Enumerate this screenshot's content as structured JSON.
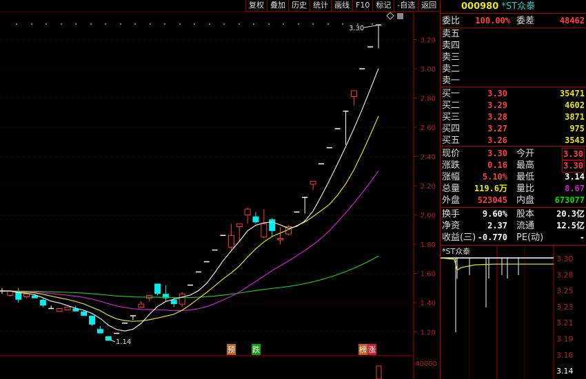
{
  "toolbar": [
    "复权",
    "叠加",
    "历史",
    "统计",
    "画线",
    "F10",
    "标记",
    "-自选",
    "返回"
  ],
  "stock": {
    "code": "000980",
    "name": "*ST众泰"
  },
  "weibi": {
    "label": "委比",
    "value": "100.00%",
    "label2": "委差",
    "value2": "48462"
  },
  "sell": [
    {
      "label": "卖五"
    },
    {
      "label": "卖四"
    },
    {
      "label": "卖三"
    },
    {
      "label": "卖二"
    },
    {
      "label": "卖一"
    }
  ],
  "buy": [
    {
      "label": "买一",
      "price": "3.30",
      "vol": "35471"
    },
    {
      "label": "买二",
      "price": "3.29",
      "vol": "4602"
    },
    {
      "label": "买三",
      "price": "3.28",
      "vol": "3871"
    },
    {
      "label": "买四",
      "price": "3.27",
      "vol": "975"
    },
    {
      "label": "买五",
      "price": "3.26",
      "vol": "3543"
    }
  ],
  "quote": [
    {
      "l1": "现价",
      "v1": "3.30",
      "c1": "red",
      "l2": "今开",
      "v2": "3.30",
      "c2": "red box"
    },
    {
      "l1": "涨跌",
      "v1": "0.16",
      "c1": "red",
      "l2": "最高",
      "v2": "3.30",
      "c2": "red box"
    },
    {
      "l1": "涨幅",
      "v1": "5.10%",
      "c1": "red",
      "l2": "最低",
      "v2": "3.14",
      "c2": "wht"
    },
    {
      "l1": "总量",
      "v1": "119.6万",
      "c1": "yel",
      "l2": "量比",
      "v2": "8.67",
      "c2": "pur"
    },
    {
      "l1": "外盘",
      "v1": "523045",
      "c1": "red",
      "l2": "内盘",
      "v2": "673077",
      "c2": "grn"
    }
  ],
  "fund": [
    {
      "l1": "换手",
      "v1": "9.60%",
      "l2": "股本",
      "v2": "20.3亿"
    },
    {
      "l1": "净资",
      "v1": "2.37",
      "l2": "流通",
      "v2": "12.5亿"
    },
    {
      "l1": "收益(三)",
      "v1": "-0.770",
      "l2": "PE(动)",
      "v2": "-"
    }
  ],
  "intraday": {
    "title": "*ST众泰",
    "axis": [
      "3.30",
      "3.28",
      "3.25",
      "3.23",
      "3.21",
      "3.19",
      "3.16",
      "3.14"
    ]
  },
  "markers": [
    {
      "text": "预",
      "color": "#c06020"
    },
    {
      "text": "跌",
      "color": "#10a010"
    },
    {
      "text": "榜",
      "color": "#c06020"
    },
    {
      "text": "涨",
      "color": "#c02030"
    }
  ],
  "colors": {
    "up": "#ff3c3c",
    "down": "#00f0f0",
    "ma5": "#e8e8e8",
    "ma10": "#e0e020",
    "ma20": "#d020d0",
    "ma60": "#20c020",
    "grid": "#5a0000"
  },
  "chart_data": {
    "type": "candlestick",
    "y_ticks": [
      "3.20",
      "3.00",
      "2.80",
      "2.60",
      "2.40",
      "2.20",
      "2.00",
      "1.80",
      "1.60",
      "1.40",
      "1.20"
    ],
    "ylim": [
      1.1,
      3.4
    ],
    "annotations": {
      "high": "3.30",
      "low": "1.14"
    },
    "volume_tick": "40000",
    "ohlc": [
      [
        1.48,
        1.5,
        1.46,
        1.48
      ],
      [
        1.45,
        1.48,
        1.44,
        1.48
      ],
      [
        1.48,
        1.5,
        1.4,
        1.42
      ],
      [
        1.44,
        1.46,
        1.43,
        1.46
      ],
      [
        1.45,
        1.46,
        1.43,
        1.43
      ],
      [
        1.42,
        1.43,
        1.37,
        1.38
      ],
      [
        1.36,
        1.38,
        1.36,
        1.36
      ],
      [
        1.34,
        1.36,
        1.34,
        1.36
      ],
      [
        1.35,
        1.37,
        1.35,
        1.37
      ],
      [
        1.36,
        1.38,
        1.34,
        1.34
      ],
      [
        1.34,
        1.35,
        1.31,
        1.31
      ],
      [
        1.31,
        1.31,
        1.24,
        1.25
      ],
      [
        1.22,
        1.24,
        1.19,
        1.19
      ],
      [
        1.17,
        1.17,
        1.14,
        1.14
      ],
      [
        1.19,
        1.19,
        1.19,
        1.19
      ],
      [
        1.26,
        1.26,
        1.26,
        1.26
      ],
      [
        1.31,
        1.31,
        1.28,
        1.31
      ],
      [
        1.37,
        1.41,
        1.37,
        1.39
      ],
      [
        1.43,
        1.45,
        1.41,
        1.45
      ],
      [
        1.53,
        1.53,
        1.45,
        1.46
      ],
      [
        1.46,
        1.52,
        1.41,
        1.43
      ],
      [
        1.42,
        1.44,
        1.37,
        1.39
      ],
      [
        1.39,
        1.47,
        1.37,
        1.46
      ],
      [
        1.52,
        1.52,
        1.52,
        1.52
      ],
      [
        1.61,
        1.61,
        1.61,
        1.61
      ],
      [
        1.68,
        1.68,
        1.68,
        1.68
      ],
      [
        1.76,
        1.76,
        1.76,
        1.76
      ],
      [
        1.86,
        1.86,
        1.86,
        1.86
      ],
      [
        1.78,
        1.94,
        1.76,
        1.86
      ],
      [
        1.92,
        1.94,
        1.82,
        1.94
      ],
      [
        2.0,
        2.05,
        1.94,
        2.04
      ],
      [
        1.99,
        2.02,
        1.94,
        1.95
      ],
      [
        1.85,
        2.04,
        1.84,
        1.94
      ],
      [
        1.97,
        1.98,
        1.85,
        1.89
      ],
      [
        1.83,
        1.92,
        1.8,
        1.84
      ],
      [
        1.87,
        1.93,
        1.86,
        1.92
      ],
      [
        2.02,
        2.02,
        2.02,
        2.02
      ],
      [
        2.12,
        2.12,
        2.01,
        2.12
      ],
      [
        2.21,
        2.23,
        2.17,
        2.23
      ],
      [
        2.35,
        2.35,
        2.35,
        2.35
      ],
      [
        2.46,
        2.46,
        2.46,
        2.46
      ],
      [
        2.59,
        2.59,
        2.59,
        2.59
      ],
      [
        2.71,
        2.71,
        2.48,
        2.71
      ],
      [
        2.81,
        2.85,
        2.75,
        2.85
      ],
      [
        3.0,
        3.0,
        3.0,
        3.0
      ],
      [
        3.15,
        3.15,
        3.15,
        3.15
      ],
      [
        3.3,
        3.3,
        3.14,
        3.3
      ]
    ]
  }
}
